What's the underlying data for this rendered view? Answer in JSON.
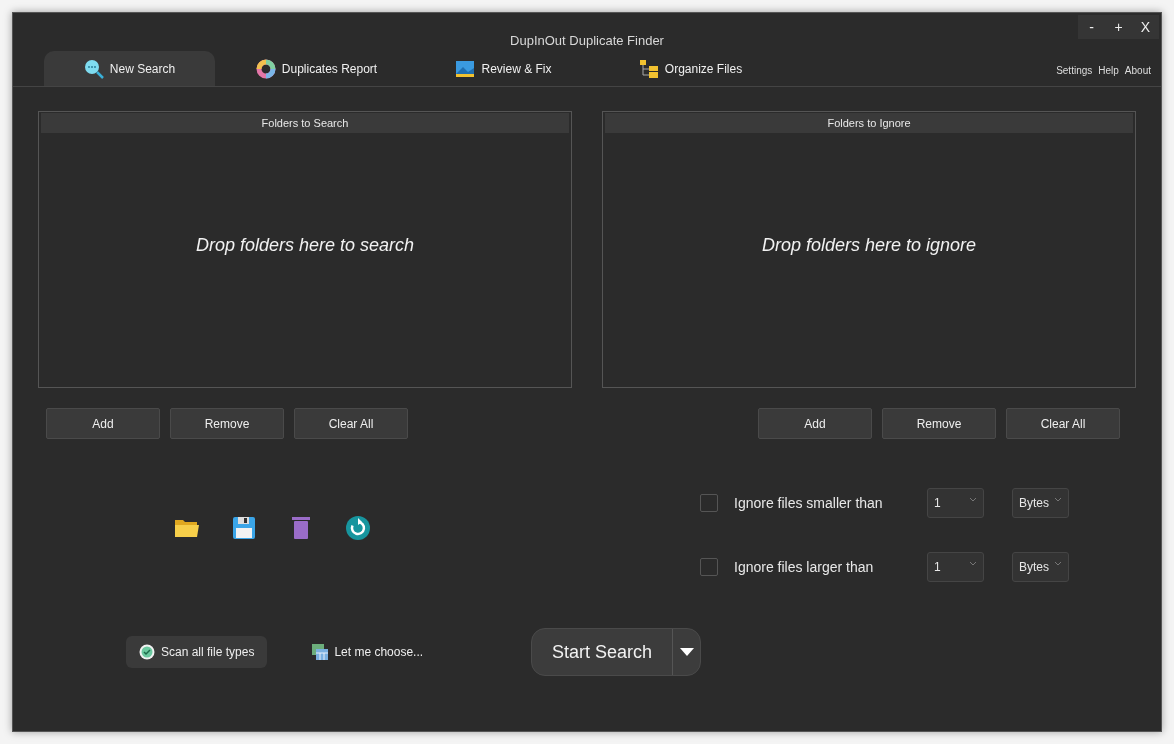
{
  "window": {
    "title": "DupInOut Duplicate Finder",
    "controls": [
      "-",
      "+",
      "X"
    ]
  },
  "tabs": [
    {
      "label": "New Search",
      "selected": true,
      "kind": "search"
    },
    {
      "label": "Duplicates Report",
      "selected": false,
      "kind": "report"
    },
    {
      "label": "Review & Fix",
      "selected": false,
      "kind": "image"
    },
    {
      "label": "Organize Files",
      "selected": false,
      "kind": "organize"
    }
  ],
  "top_links": [
    "Settings",
    "Help",
    "About"
  ],
  "panels": [
    {
      "title": "Folders to Search",
      "hint": "Drop folders here to search",
      "buttons": [
        "Add",
        "Remove",
        "Clear All"
      ]
    },
    {
      "title": "Folders to Ignore",
      "hint": "Drop folders here to ignore",
      "buttons": [
        "Add",
        "Remove",
        "Clear All"
      ]
    }
  ],
  "file_type_options": [
    {
      "label": "Scan all file types",
      "selected": true,
      "kind": "check"
    },
    {
      "label": "Let me choose...",
      "selected": false,
      "kind": "grid"
    }
  ],
  "start_search": {
    "label": "Start Search"
  },
  "filters": [
    {
      "label": "Ignore files smaller than",
      "checked": false,
      "value": "1",
      "unit": "Bytes"
    },
    {
      "label": "Ignore files larger than",
      "checked": false,
      "value": "1",
      "unit": "Bytes"
    }
  ]
}
